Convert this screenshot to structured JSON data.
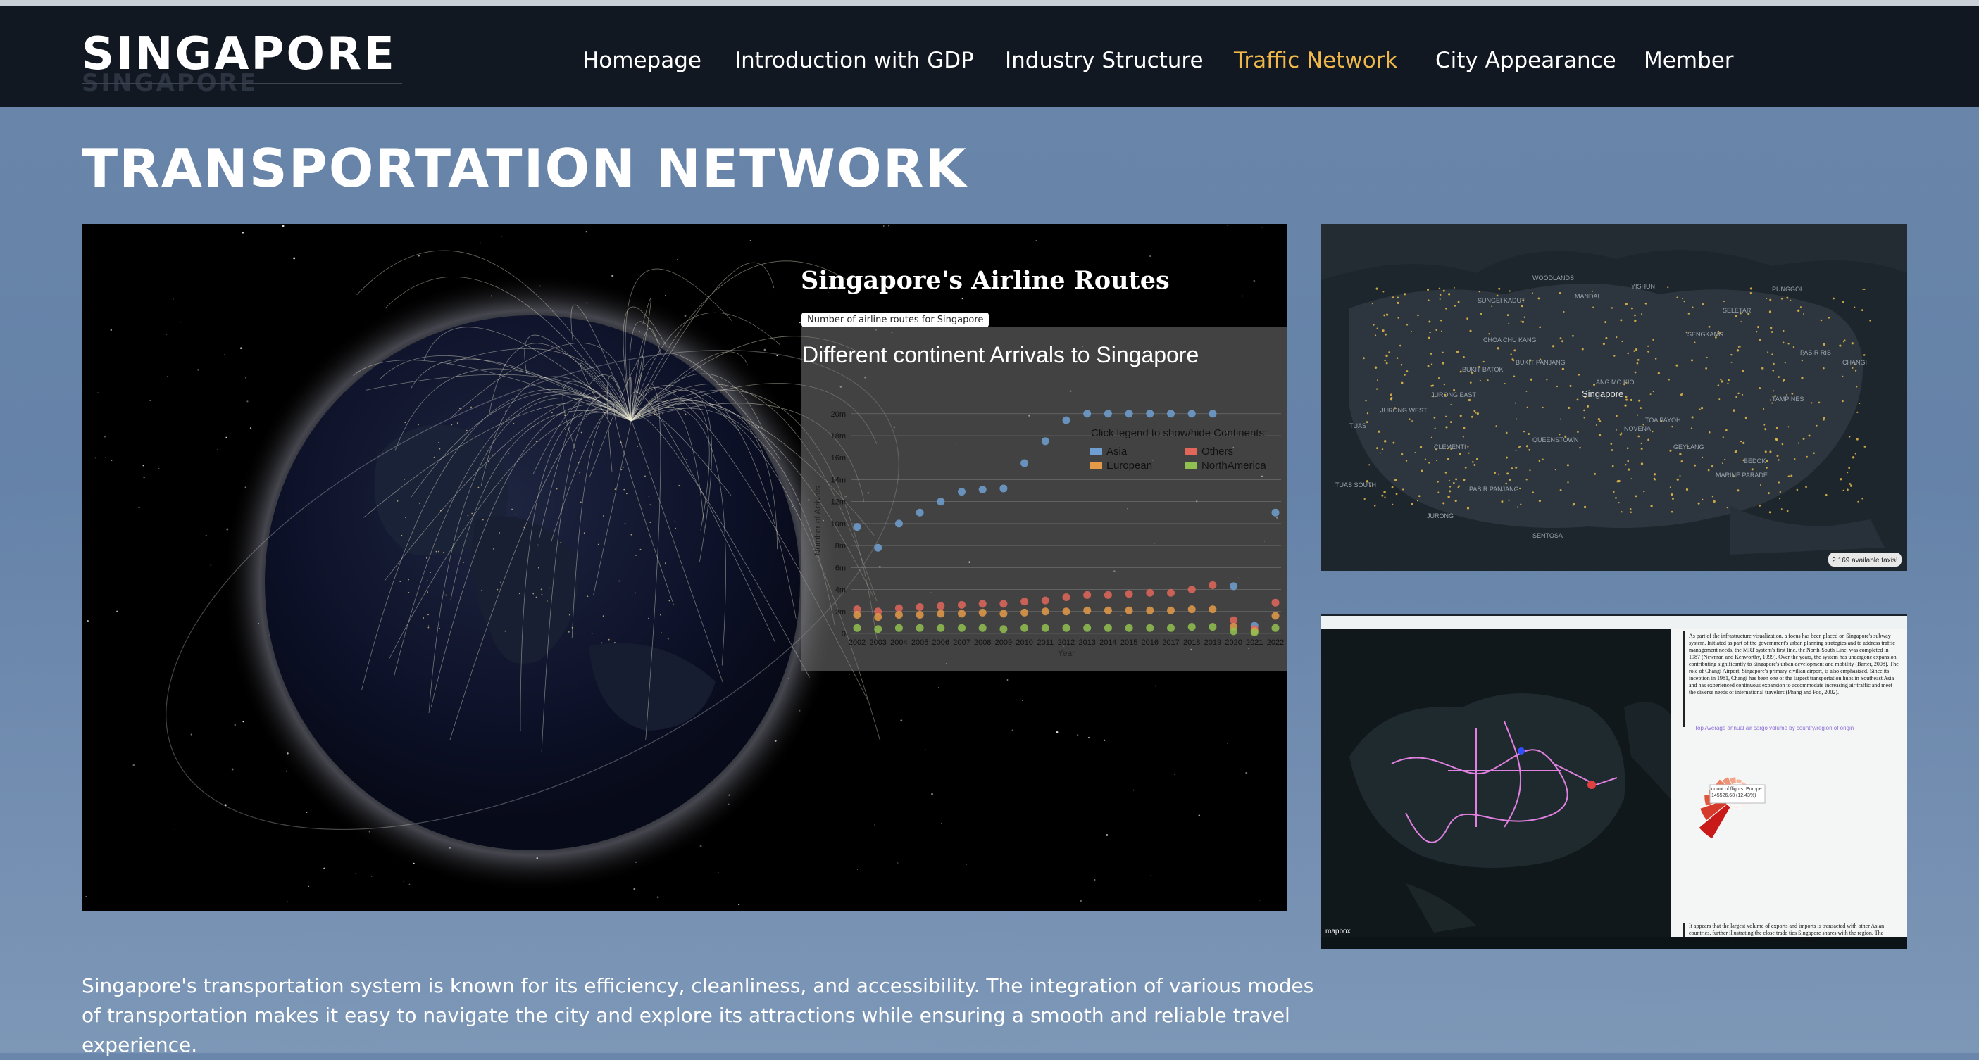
{
  "brand": "SINGAPORE",
  "brand_shadow": "SINGAPORE",
  "nav": {
    "items": [
      {
        "label": "Homepage",
        "active": false
      },
      {
        "label": "Introduction with GDP",
        "active": false
      },
      {
        "label": "Industry Structure",
        "active": false
      },
      {
        "label": "Traffic Network",
        "active": true
      },
      {
        "label": "City Appearance",
        "active": false
      },
      {
        "label": "Member",
        "active": false
      }
    ]
  },
  "page_title": "TRANSPORTATION NETWORK",
  "globe_panel": {
    "title": "Singapore's Airline Routes",
    "button_label": "Number of airline routes for Singapore"
  },
  "chart_data": {
    "type": "scatter",
    "title": "Different continent Arrivals to Singapore",
    "xlabel": "Year",
    "ylabel": "Number of Arrivals",
    "legend_title": "Click legend to show/hide Continents:",
    "legend_position": "top-right",
    "x": [
      2002,
      2003,
      2004,
      2005,
      2006,
      2007,
      2008,
      2009,
      2010,
      2011,
      2012,
      2013,
      2014,
      2015,
      2016,
      2017,
      2018,
      2019,
      2020,
      2021,
      2022
    ],
    "x_tick_labels": [
      "2002",
      "2003",
      "2004",
      "2005",
      "2006",
      "2007",
      "2008",
      "2009",
      "2010",
      "2011",
      "2012",
      "2013",
      "2014",
      "2015",
      "2016",
      "2017",
      "2018",
      "2019",
      "2020",
      "2021",
      "2022"
    ],
    "y_tick_labels": [
      "0",
      "2m",
      "4m",
      "6m",
      "8m",
      "10m",
      "12m",
      "14m",
      "16m",
      "18m",
      "20m"
    ],
    "ylim": [
      0,
      20500000
    ],
    "grid": true,
    "series": [
      {
        "name": "Asia",
        "color": "#6f9fd0",
        "values": [
          9700000,
          7800000,
          10000000,
          11000000,
          12000000,
          12900000,
          13100000,
          13200000,
          15500000,
          17500000,
          19400000,
          20000000,
          20000000,
          20000000,
          20000000,
          20000000,
          20000000,
          20000000,
          4300000,
          700000,
          11000000
        ]
      },
      {
        "name": "Others",
        "color": "#e2665a",
        "values": [
          2200000,
          2000000,
          2300000,
          2400000,
          2500000,
          2600000,
          2700000,
          2700000,
          2900000,
          3000000,
          3300000,
          3500000,
          3500000,
          3600000,
          3700000,
          3700000,
          4000000,
          4400000,
          1200000,
          400000,
          2800000
        ]
      },
      {
        "name": "European",
        "color": "#e39a48",
        "values": [
          1700000,
          1500000,
          1700000,
          1700000,
          1800000,
          1800000,
          1900000,
          1800000,
          1900000,
          2000000,
          2000000,
          2100000,
          2100000,
          2100000,
          2100000,
          2100000,
          2200000,
          2200000,
          600000,
          200000,
          1600000
        ]
      },
      {
        "name": "NorthAmerica",
        "color": "#90c04f",
        "values": [
          500000,
          400000,
          500000,
          500000,
          500000,
          500000,
          500000,
          400000,
          500000,
          500000,
          500000,
          500000,
          500000,
          500000,
          500000,
          500000,
          600000,
          600000,
          200000,
          100000,
          500000
        ]
      }
    ]
  },
  "map1": {
    "status_badge": "2,169 available taxis!",
    "labels": [
      "Singapore",
      "Woodlands",
      "Mandai",
      "Seletar",
      "Sungei Kadut",
      "Yishun",
      "Punggol",
      "Choa Chu Kang",
      "Sengkang",
      "Bukit Panjang",
      "Jurong West",
      "Jurong East",
      "Bukit Batok",
      "Ang Mo Kio",
      "Tampines",
      "Pasir Ris",
      "Changi",
      "Clementi",
      "Queenstown",
      "Toa Payoh",
      "Bedok",
      "Sentosa",
      "Tuas",
      "Tuas South",
      "Jurong",
      "Pasir Panjang",
      "Geylang",
      "Novena",
      "Marine Parade"
    ]
  },
  "map2": {
    "attribution": "mapbox",
    "side_text_top": "As part of the infrastructure visualization, a focus has been placed on Singapore's subway system. Initiated as part of the government's urban planning strategies and to address traffic management needs, the MRT system's first line, the North-South Line, was completed in 1987 (Newman and Kenworthy, 1999). Over the years, the system has undergone expansion, contributing significantly to Singapore's urban development and mobility (Barter, 2008). The role of Changi Airport, Singapore's primary civilian airport, is also emphasized. Since its inception in 1981, Changi has been one of the largest transportation hubs in Southeast Asia and has experienced continuous expansion to accommodate increasing air traffic and meet the diverse needs of international travelers (Phang and Foo, 2002).",
    "chart_title": "Top Average annual air cargo volume by country/region of origin",
    "tooltip": "count of flights: Europe : 145526.68 (12.43%)",
    "side_text_bottom": "It appears that the largest volume of exports and imports is transacted with other Asian countries, further illustrating the close trade ties Singapore shares with the region. The significant amount of imports from Mainland China and"
  },
  "caption": "Singapore's transportation system is known for its efficiency, cleanliness, and accessibility. The integration of various modes of transportation makes it easy to navigate the city and explore its attractions while ensuring a smooth and reliable travel experience."
}
